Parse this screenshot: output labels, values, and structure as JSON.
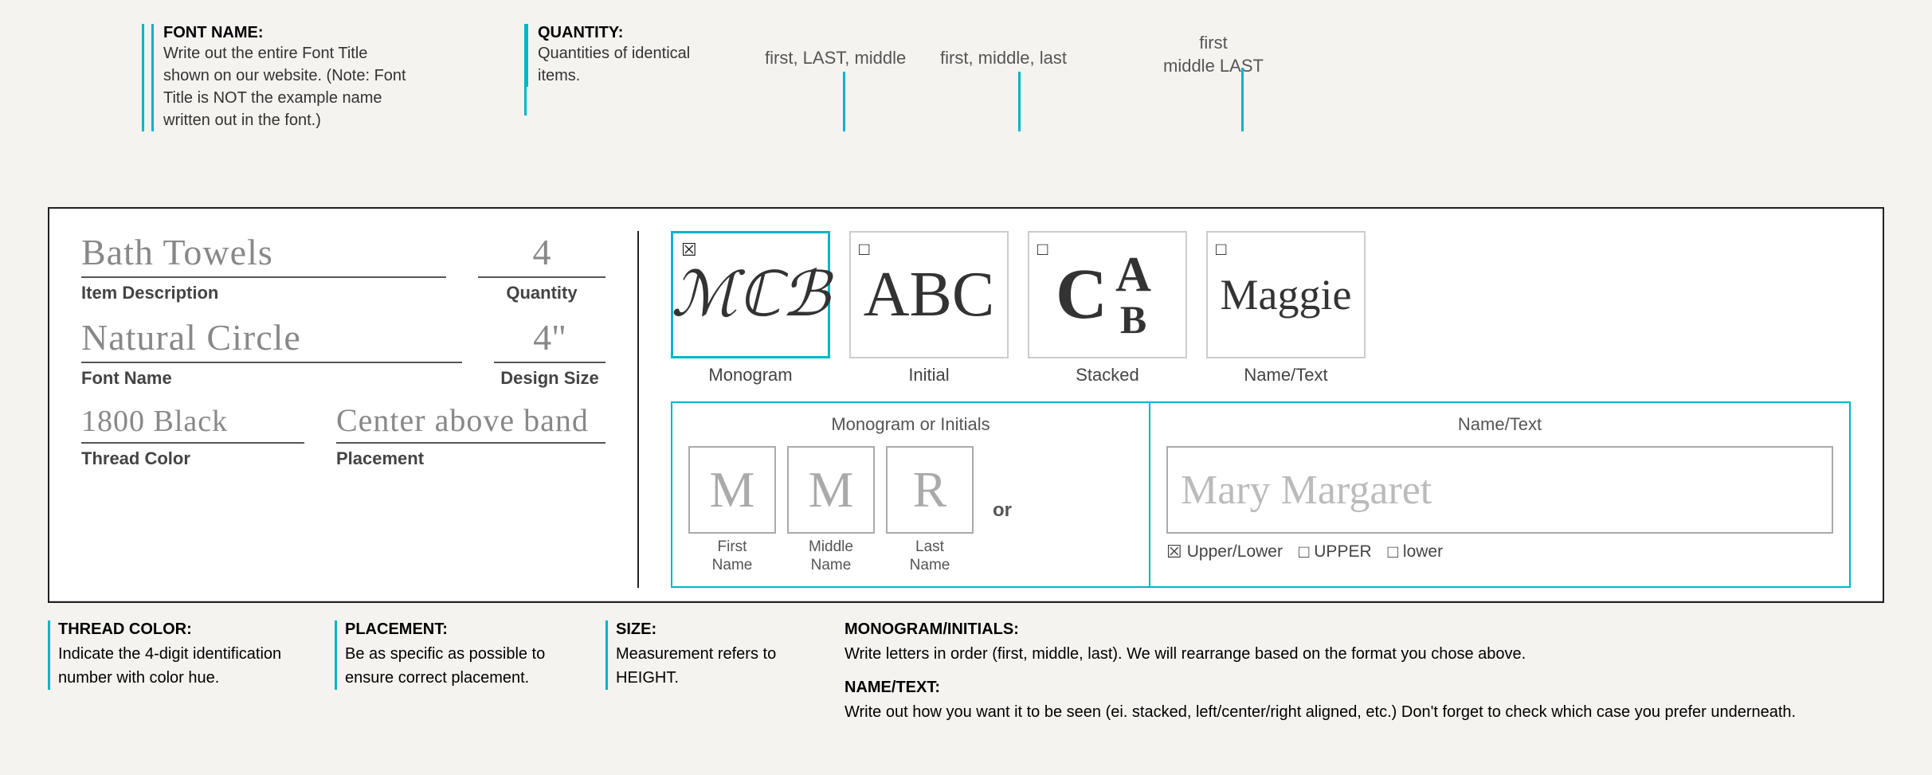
{
  "annotations": {
    "font_name_title": "FONT NAME:",
    "font_name_desc": "Write out the entire Font Title shown on our website. (Note: Font Title is NOT the example name written out in the font.)",
    "quantity_title": "QUANTITY:",
    "quantity_desc": "Quantities of identical items.",
    "order1": "first, LAST, middle",
    "order2": "first, middle, last",
    "order3_line1": "first",
    "order3_line2": "middle LAST"
  },
  "form": {
    "item_description_value": "Bath Towels",
    "item_description_label": "Item Description",
    "quantity_value": "4",
    "quantity_label": "Quantity",
    "font_name_value": "Natural Circle",
    "font_name_label": "Font Name",
    "design_size_value": "4\"",
    "design_size_label": "Design Size",
    "thread_color_value": "1800 Black",
    "thread_color_label": "Thread Color",
    "placement_value": "Center above band",
    "placement_label": "Placement"
  },
  "styles": [
    {
      "id": "monogram",
      "selected": true,
      "symbol": "☒",
      "display": "MCB",
      "label": "Monogram"
    },
    {
      "id": "initial",
      "selected": false,
      "symbol": "□",
      "display": "ABC",
      "label": "Initial"
    },
    {
      "id": "stacked",
      "selected": false,
      "symbol": "□",
      "display": "stacked",
      "label": "Stacked"
    },
    {
      "id": "name_text",
      "selected": false,
      "symbol": "□",
      "display": "Maggie",
      "label": "Name/Text"
    }
  ],
  "monogram_initials": {
    "section_title": "Monogram or Initials",
    "first_letter": "M",
    "middle_letter": "M",
    "last_letter": "R",
    "first_label": "First\nName",
    "middle_label": "Middle\nName",
    "last_label": "Last\nName",
    "or_label": "or"
  },
  "name_text": {
    "section_title": "Name/Text",
    "placeholder": "Mary Margaret",
    "case_upper_lower": "Upper/Lower",
    "case_upper_lower_checked": true,
    "case_upper": "UPPER",
    "case_upper_checked": false,
    "case_lower": "lower",
    "case_lower_checked": false
  },
  "bottom_annotations": {
    "thread_color_title": "THREAD COLOR:",
    "thread_color_desc": "Indicate the 4-digit identification number with color hue.",
    "placement_title": "PLACEMENT:",
    "placement_desc": "Be as specific as possible to ensure correct placement.",
    "size_title": "SIZE:",
    "size_desc": "Measurement refers to HEIGHT.",
    "monogram_title": "MONOGRAM/INITIALS:",
    "monogram_desc": "Write letters in order (first, middle, last). We will rearrange based on the format you chose above.",
    "name_text_title": "NAME/TEXT:",
    "name_text_desc": "Write out how you want it to be seen (ei. stacked, left/center/right aligned, etc.) Don't forget to check which case you prefer underneath."
  }
}
